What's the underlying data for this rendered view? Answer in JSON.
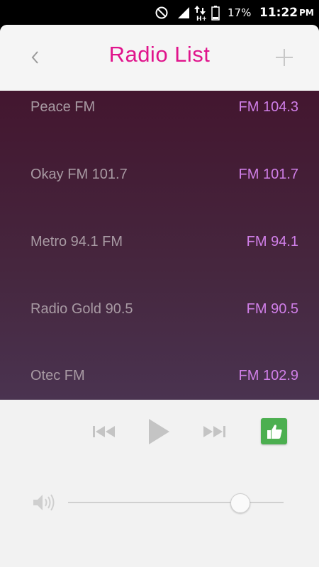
{
  "status_bar": {
    "battery_percent": "17%",
    "time": "11:22",
    "ampm": "PM",
    "icons": [
      "do-not-disturb-icon",
      "signal-icon",
      "data-arrows-icon",
      "battery-icon"
    ]
  },
  "header": {
    "title": "Radio List",
    "back_icon": "chevron-left-icon",
    "add_icon": "plus-icon",
    "title_color": "#e0148c"
  },
  "stations": [
    {
      "name": "Peace FM",
      "frequency": "FM 104.3"
    },
    {
      "name": "Okay FM 101.7",
      "frequency": "FM 101.7"
    },
    {
      "name": "Metro 94.1 FM",
      "frequency": "FM 94.1"
    },
    {
      "name": "Radio Gold 90.5",
      "frequency": "FM 90.5"
    },
    {
      "name": "Otec FM",
      "frequency": "FM 102.9"
    }
  ],
  "player": {
    "icons": [
      "previous-icon",
      "play-icon",
      "next-icon",
      "thumbs-up-icon",
      "volume-icon"
    ],
    "volume_level": 0.83,
    "accent_color": "#4caf50"
  }
}
